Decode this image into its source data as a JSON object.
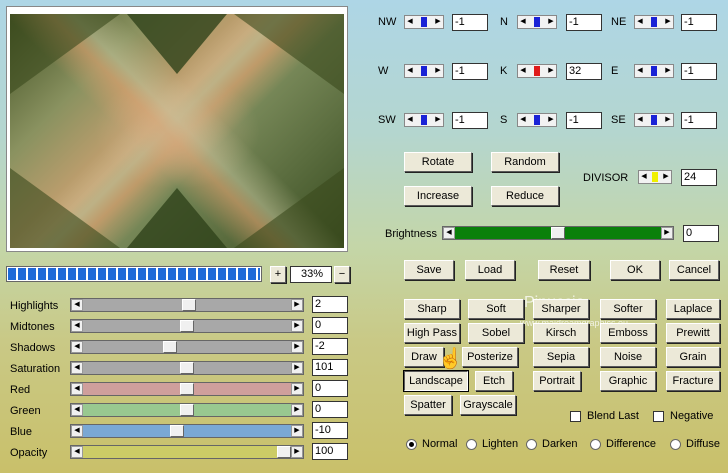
{
  "matrix": {
    "rows": [
      [
        {
          "label": "NW",
          "value": "-1",
          "color": "#1a22d6"
        },
        {
          "label": "N",
          "value": "-1",
          "color": "#1a22d6"
        },
        {
          "label": "NE",
          "value": "-1",
          "color": "#1a22d6"
        }
      ],
      [
        {
          "label": "W",
          "value": "-1",
          "color": "#1a22d6"
        },
        {
          "label": "K",
          "value": "32",
          "color": "#e01a1a"
        },
        {
          "label": "E",
          "value": "-1",
          "color": "#1a22d6"
        }
      ],
      [
        {
          "label": "SW",
          "value": "-1",
          "color": "#1a22d6"
        },
        {
          "label": "S",
          "value": "-1",
          "color": "#1a22d6"
        },
        {
          "label": "SE",
          "value": "-1",
          "color": "#1a22d6"
        }
      ]
    ]
  },
  "actions": {
    "rotate": "Rotate",
    "random": "Random",
    "increase": "Increase",
    "reduce": "Reduce"
  },
  "divisor": {
    "label": "DIVISOR",
    "value": "24",
    "color": "#f0f000"
  },
  "brightness": {
    "label": "Brightness",
    "value": "0",
    "level": 0.5
  },
  "file_buttons": {
    "save": "Save",
    "load": "Load",
    "reset": "Reset",
    "ok": "OK",
    "cancel": "Cancel"
  },
  "presets": [
    "Sharp",
    "Soft",
    "Sharper",
    "Softer",
    "Laplace",
    "High Pass",
    "Sobel",
    "Kirsch",
    "Emboss",
    "Prewitt",
    "Draw",
    "Posterize",
    "Sepia",
    "Noise",
    "Grain",
    "Landscape",
    "Etch",
    "Portrait",
    "Graphic",
    "Fracture",
    "Spatter",
    "Grayscale"
  ],
  "options": {
    "blend_last": "Blend Last",
    "negative": "Negative"
  },
  "modes": [
    {
      "label": "Normal",
      "selected": true
    },
    {
      "label": "Lighten",
      "selected": false
    },
    {
      "label": "Darken",
      "selected": false
    },
    {
      "label": "Difference",
      "selected": false
    },
    {
      "label": "Diffuse",
      "selected": false
    }
  ],
  "zoom": {
    "value": "33%",
    "plus": "+",
    "minus": "−",
    "progress": 1.0
  },
  "adjust": [
    {
      "label": "Highlights",
      "value": "2",
      "color": "#a8a8a8",
      "level": 0.51
    },
    {
      "label": "Midtones",
      "value": "0",
      "color": "#a8a8a8",
      "level": 0.5
    },
    {
      "label": "Shadows",
      "value": "-2",
      "color": "#a8a8a8",
      "level": 0.41
    },
    {
      "label": "Saturation",
      "value": "101",
      "color": "#a8a8a8",
      "level": 0.5
    },
    {
      "label": "Red",
      "value": "0",
      "color": "#cf9f9c",
      "level": 0.5
    },
    {
      "label": "Green",
      "value": "0",
      "color": "#98c890",
      "level": 0.5
    },
    {
      "label": "Blue",
      "value": "-10",
      "color": "#7aa8d4",
      "level": 0.45
    },
    {
      "label": "Opacity",
      "value": "100",
      "color": "#cccc66",
      "level": 1.0
    }
  ],
  "watermark": {
    "title": "Pinuccia",
    "subtitle": "www.maidreamgraphics.eu"
  }
}
